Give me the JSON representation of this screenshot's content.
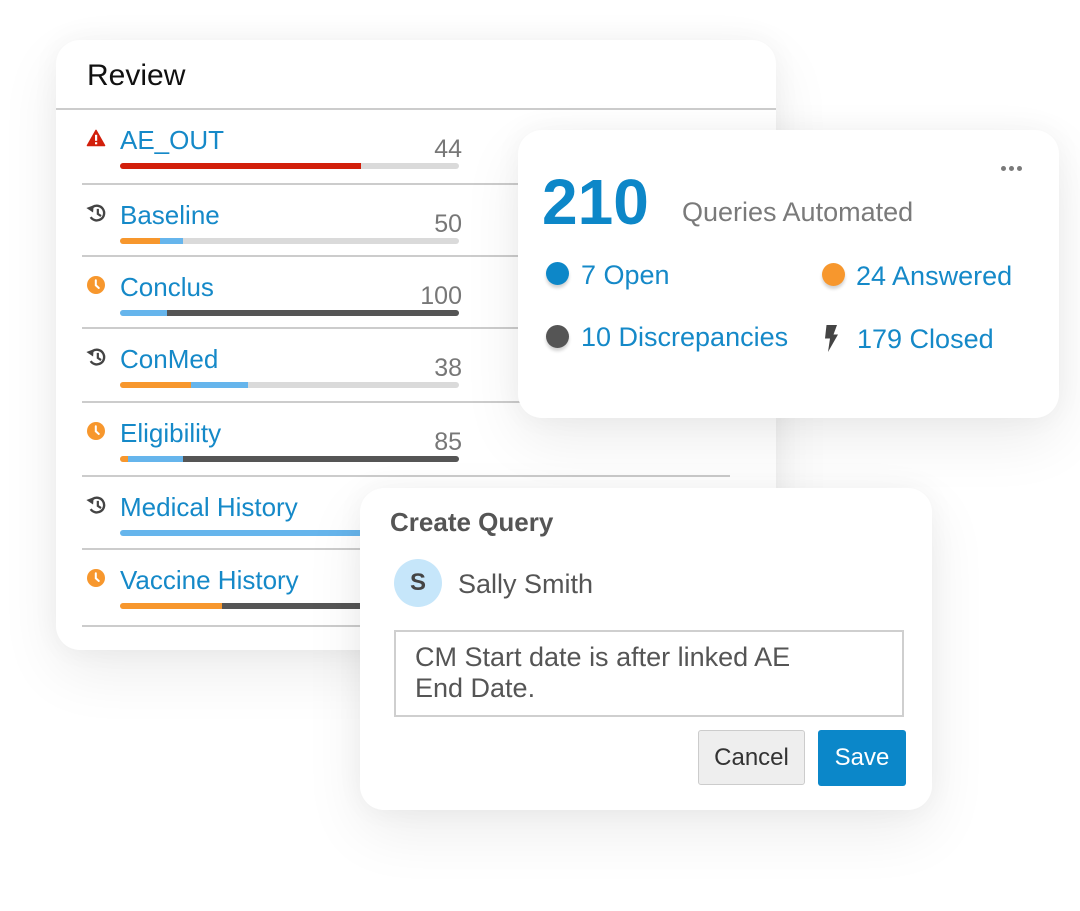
{
  "review": {
    "title": "Review",
    "items": [
      {
        "label": "AE_OUT",
        "icon": "warning",
        "count": "44",
        "segments": [
          {
            "color": "red",
            "fraction": 0.71
          }
        ]
      },
      {
        "label": "Baseline",
        "icon": "history",
        "count": "50",
        "segments": [
          {
            "color": "orange",
            "fraction": 0.118
          },
          {
            "color": "blue",
            "fraction": 0.068
          }
        ]
      },
      {
        "label": "Conclus",
        "icon": "clock",
        "count": "100",
        "segments": [
          {
            "color": "blue",
            "fraction": 0.139
          },
          {
            "color": "dark",
            "fraction": 0.861
          }
        ]
      },
      {
        "label": "ConMed",
        "icon": "history",
        "count": "38",
        "segments": [
          {
            "color": "orange",
            "fraction": 0.209
          },
          {
            "color": "blue",
            "fraction": 0.168
          }
        ]
      },
      {
        "label": "Eligibility",
        "icon": "clock",
        "count": "85",
        "segments": [
          {
            "color": "orange",
            "fraction": 0.023
          },
          {
            "color": "blue",
            "fraction": 0.162
          },
          {
            "color": "dark",
            "fraction": 0.815
          }
        ]
      },
      {
        "label": "Medical History",
        "icon": "history",
        "segments": [
          {
            "color": "blue",
            "fraction": 1.0
          }
        ]
      },
      {
        "label": "Vaccine History",
        "icon": "clock",
        "segments": [
          {
            "color": "orange",
            "fraction": 0.3
          },
          {
            "color": "dark",
            "fraction": 0.7
          }
        ]
      }
    ]
  },
  "bar_colors": {
    "red": "#d21f0b",
    "orange": "#f7972d",
    "blue": "#66b5ec",
    "dark": "#555555",
    "track": "#dadada"
  },
  "summary": {
    "total": "210",
    "total_label": "Queries Automated",
    "menu_icon": "more-horizontal",
    "stats": [
      {
        "label": "7 Open",
        "icon": "dot",
        "color": "#0d87c8"
      },
      {
        "label": "24 Answered",
        "icon": "dot",
        "color": "#f7972d"
      },
      {
        "label": "10 Discrepancies",
        "icon": "dot",
        "color": "#555555"
      },
      {
        "label": "179 Closed",
        "icon": "bolt",
        "color": "#444444"
      }
    ]
  },
  "create_query": {
    "title": "Create Query",
    "user": {
      "initial": "S",
      "name": "Sally Smith"
    },
    "message": "CM Start date is after linked AE End Date.",
    "cancel_label": "Cancel",
    "save_label": "Save"
  }
}
